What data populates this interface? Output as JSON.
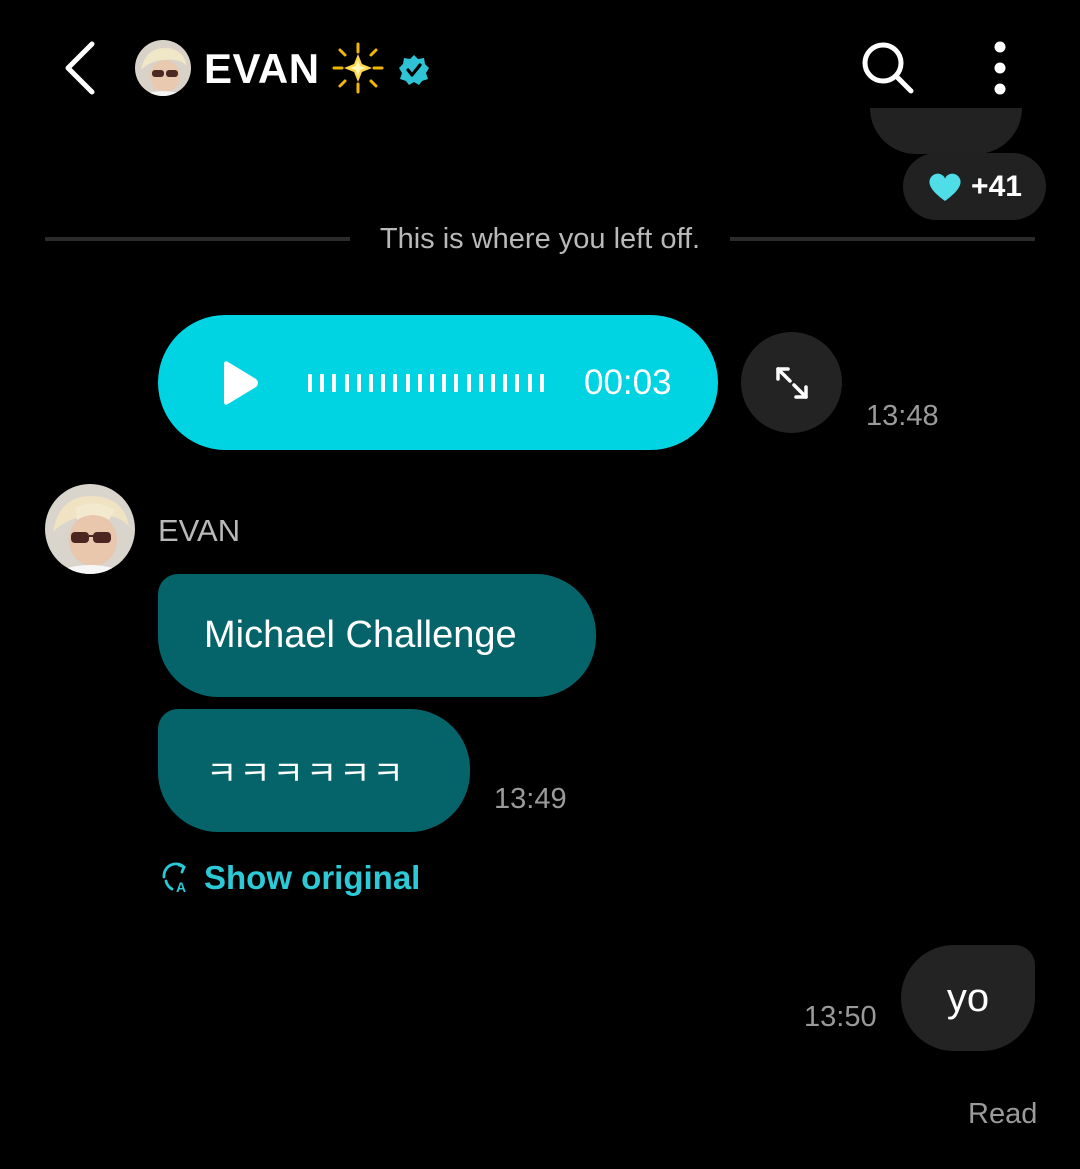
{
  "header": {
    "contact_name": "EVAN",
    "icons": [
      "back-icon",
      "avatar",
      "sparkle-star-icon",
      "verified-badge-icon",
      "search-icon",
      "more-vertical-icon"
    ]
  },
  "previous_message": {
    "reaction_icon": "heart-icon",
    "reaction_color": "#4fdde8",
    "reaction_count": "+41"
  },
  "divider": {
    "text": "This is where you left off."
  },
  "voice_message": {
    "duration": "00:03",
    "time": "13:48",
    "color": "#00d4e2"
  },
  "incoming": {
    "sender": "EVAN",
    "messages": [
      "Michael Challenge",
      "ㅋㅋㅋㅋㅋㅋ"
    ],
    "time": "13:49",
    "show_original_label": "Show original",
    "bubble_color": "#05636a"
  },
  "outgoing": {
    "text": "yo",
    "time": "13:50",
    "status": "Read"
  }
}
